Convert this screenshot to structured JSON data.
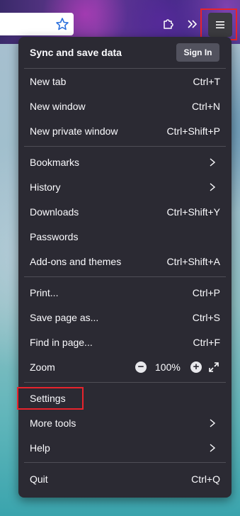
{
  "toolbar": {
    "bookmark_icon": "star-icon",
    "extensions_icon": "puzzle-icon",
    "overflow_icon": "double-chevron-icon",
    "menu_icon": "hamburger-icon"
  },
  "menu": {
    "sync_title": "Sync and save data",
    "sign_in_label": "Sign In",
    "items": [
      {
        "label": "New tab",
        "shortcut": "Ctrl+T"
      },
      {
        "label": "New window",
        "shortcut": "Ctrl+N"
      },
      {
        "label": "New private window",
        "shortcut": "Ctrl+Shift+P"
      },
      {
        "label": "Bookmarks",
        "shortcut": ""
      },
      {
        "label": "History",
        "shortcut": ""
      },
      {
        "label": "Downloads",
        "shortcut": "Ctrl+Shift+Y"
      },
      {
        "label": "Passwords",
        "shortcut": ""
      },
      {
        "label": "Add-ons and themes",
        "shortcut": "Ctrl+Shift+A"
      },
      {
        "label": "Print...",
        "shortcut": "Ctrl+P"
      },
      {
        "label": "Save page as...",
        "shortcut": "Ctrl+S"
      },
      {
        "label": "Find in page...",
        "shortcut": "Ctrl+F"
      },
      {
        "label": "Zoom",
        "shortcut": ""
      },
      {
        "label": "Settings",
        "shortcut": ""
      },
      {
        "label": "More tools",
        "shortcut": ""
      },
      {
        "label": "Help",
        "shortcut": ""
      },
      {
        "label": "Quit",
        "shortcut": "Ctrl+Q"
      }
    ],
    "zoom_level": "100%",
    "zoom_minus": "−",
    "zoom_plus": "+"
  },
  "colors": {
    "menu_bg": "#2b2a33",
    "highlight": "#e8232c",
    "text": "#fbfbfe"
  }
}
